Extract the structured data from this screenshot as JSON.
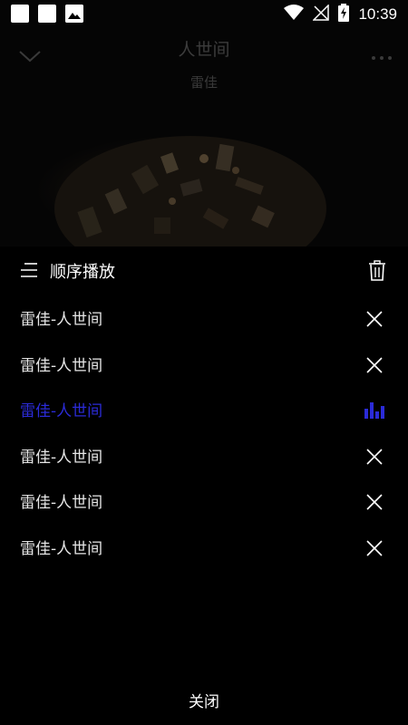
{
  "status_bar": {
    "time": "10:39",
    "icons": [
      "notification-square-icon",
      "notification-square-icon",
      "image-icon",
      "wifi-icon",
      "no-signal-icon",
      "battery-charging-icon"
    ]
  },
  "player": {
    "title": "人世间",
    "artist": "雷佳"
  },
  "sheet": {
    "mode_label": "顺序播放",
    "close_label": "关闭",
    "playing_index": 2,
    "items": [
      {
        "title": "雷佳-人世间"
      },
      {
        "title": "雷佳-人世间"
      },
      {
        "title": "雷佳-人世间"
      },
      {
        "title": "雷佳-人世间"
      },
      {
        "title": "雷佳-人世间"
      },
      {
        "title": "雷佳-人世间"
      }
    ]
  },
  "colors": {
    "accent": "#2b2bd8",
    "background": "#000000",
    "text": "#e6e6e6"
  }
}
